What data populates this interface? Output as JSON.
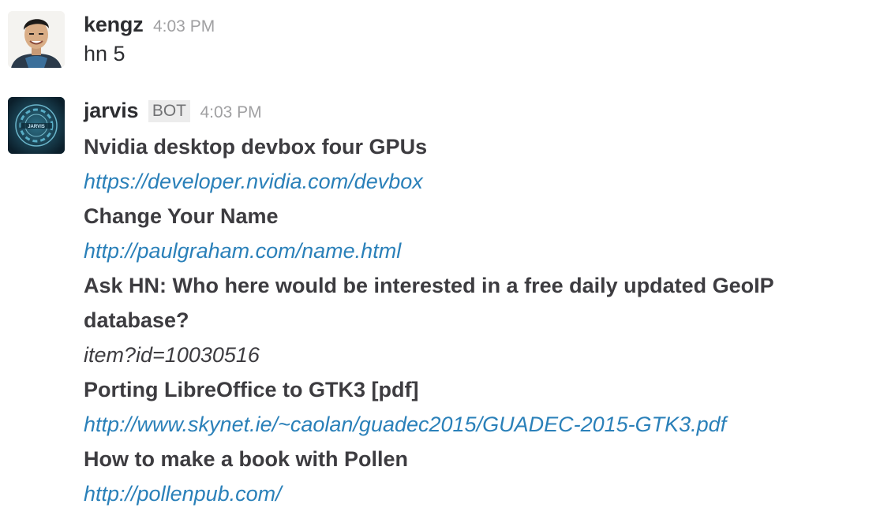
{
  "messages": [
    {
      "username": "kengz",
      "timestamp": "4:03 PM",
      "text": "hn 5"
    },
    {
      "username": "jarvis",
      "badge": "BOT",
      "timestamp": "4:03 PM",
      "avatar_text": "JARVIS",
      "items": [
        {
          "title": "Nvidia desktop devbox four GPUs",
          "link": "https://developer.nvidia.com/devbox"
        },
        {
          "title": "Change Your Name",
          "link": "http://paulgraham.com/name.html"
        },
        {
          "title_line1": "Ask HN: Who here would be interested in a free daily updated GeoIP",
          "title_line2": "database?",
          "link": "item?id=10030516"
        },
        {
          "title": "Porting LibreOffice to GTK3 [pdf]",
          "link": "http://www.skynet.ie/~caolan/guadec2015/GUADEC-2015-GTK3.pdf"
        },
        {
          "title": "How to make a book with Pollen",
          "link": "http://pollenpub.com/"
        }
      ]
    }
  ],
  "colors": {
    "link": "#2a80b9",
    "timestamp": "#a0a0a2",
    "text": "#2c2d30"
  }
}
